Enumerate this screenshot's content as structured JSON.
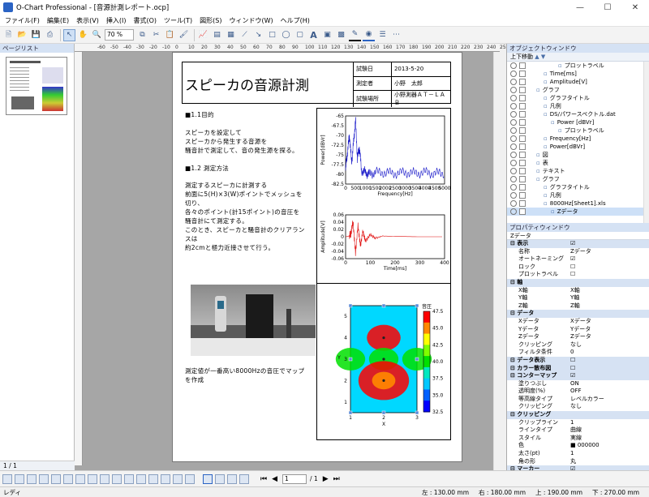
{
  "window": {
    "title": "O-Chart Professional - [音源計測レポート.ocp]"
  },
  "menu": [
    "ファイル(F)",
    "編集(E)",
    "表示(V)",
    "挿入(I)",
    "書式(O)",
    "ツール(T)",
    "図形(S)",
    "ウィンドウ(W)",
    "ヘルプ(H)"
  ],
  "toolbar": {
    "zoom": "70 %"
  },
  "pagelist": {
    "title": "ページリスト",
    "page_counter": "1 / 1"
  },
  "ruler": {
    "ticks": [
      "-60",
      "-50",
      "-40",
      "-30",
      "-20",
      "-10",
      "0",
      "10",
      "20",
      "30",
      "40",
      "50",
      "60",
      "70",
      "80",
      "90",
      "100",
      "110",
      "120",
      "130",
      "140",
      "150",
      "160",
      "170",
      "180",
      "190",
      "200",
      "210",
      "220",
      "230",
      "240",
      "250"
    ]
  },
  "report": {
    "title": "スピーカの音源計測",
    "info": [
      {
        "label": "試験日",
        "value": "2013-5-20"
      },
      {
        "label": "測定者",
        "value": "小野　太郎"
      },
      {
        "label": "試験場所",
        "value": "小野測器ＡＴ－ＬＡＢ"
      }
    ],
    "section1_heading": "■1.1目的",
    "section1_body": [
      "スピーカを設定して",
      "スピーカから発生する音源を",
      "騒音計で測定して、音の発生源を探る。"
    ],
    "section2_heading": "■1.2 測定方法",
    "section2_body": [
      "測定するスピーカに計測する",
      "前面に5(H)×3(W)ポイントでメッシュを",
      "切り、",
      "各々のポイント(計15ポイント)の音圧を",
      "騒音計にて測定する。",
      "このとき、スピーカと騒音計のクリアラン",
      "スは",
      "約2cmと極力近接させて行う。"
    ],
    "photo_caption": [
      "測定値が一番高い8000Hzの音圧でマップ",
      "を作成"
    ]
  },
  "colors": {
    "spectrum": "#1515c8",
    "waveform": "#e01010",
    "panel_head": "#d5e2f4",
    "selection": "#cde0f7"
  },
  "chart_data": [
    {
      "type": "line",
      "title": "",
      "xlabel": "Frequency[Hz]",
      "ylabel": "Power[dBVr]",
      "xlim": [
        0,
        5000
      ],
      "ylim": [
        -82.5,
        -65
      ],
      "x_ticks": [
        "0",
        "500",
        "1000",
        "1500",
        "2000",
        "2500",
        "3000",
        "3500",
        "4000",
        "4500",
        "5000"
      ],
      "y_ticks": [
        "-65",
        "-67.5",
        "-70",
        "-72.5",
        "-75",
        "-77.5",
        "-80",
        "-82.5"
      ],
      "series": [
        {
          "x": [
            0,
            100,
            200,
            300,
            400,
            500,
            600,
            700,
            800,
            1000,
            1200,
            1500,
            2000,
            2500,
            3000,
            3500,
            4000,
            4500,
            5000
          ],
          "values": [
            -79,
            -74,
            -70,
            -77,
            -72,
            -66,
            -76,
            -73,
            -79,
            -79.5,
            -80,
            -79.5,
            -79.5,
            -79.8,
            -79.5,
            -79.7,
            -79.5,
            -79.8,
            -79.6
          ]
        }
      ]
    },
    {
      "type": "line",
      "title": "",
      "xlabel": "Time[ms]",
      "ylabel": "Amplitude[V]",
      "xlim": [
        0,
        400
      ],
      "ylim": [
        -0.06,
        0.06
      ],
      "x_ticks": [
        "0",
        "100",
        "200",
        "300",
        "400"
      ],
      "y_ticks": [
        "0.06",
        "0.04",
        "0.02",
        "0",
        "-0.02",
        "-0.04",
        "-0.06"
      ],
      "series": [
        {
          "x": [
            0,
            10,
            20,
            30,
            40,
            50,
            60,
            70,
            80,
            100,
            120,
            150,
            200,
            300,
            400
          ],
          "values": [
            0,
            0.001,
            0.005,
            0.04,
            -0.045,
            0.03,
            -0.025,
            0.015,
            -0.012,
            0.006,
            -0.004,
            0.002,
            0.001,
            0,
            0
          ]
        }
      ]
    },
    {
      "type": "heatmap",
      "title": "",
      "xlabel": "X",
      "ylabel": "Y",
      "colorbar_label": "音圧",
      "x_ticks": [
        "1",
        "2",
        "3"
      ],
      "y_ticks": [
        "1",
        "2",
        "3",
        "4",
        "5"
      ],
      "colorbar_ticks": [
        "32.5",
        "35.0",
        "37.5",
        "40.0",
        "42.5",
        "45.0",
        "47.5"
      ],
      "zlim": [
        32.5,
        47.5
      ],
      "points": [
        {
          "x": 2,
          "y": 4,
          "z": 44
        },
        {
          "x": 2,
          "y": 3,
          "z": 37
        },
        {
          "x": 2,
          "y": 2,
          "z": 47.5
        },
        {
          "x": 1,
          "y": 3,
          "z": 40
        },
        {
          "x": 3,
          "y": 3,
          "z": 40
        }
      ]
    }
  ],
  "object_window": {
    "title": "オブジェクトウィンドウ",
    "toolbar": "上下移動",
    "tree": [
      {
        "label": "プロットラベル",
        "indent": 4
      },
      {
        "label": "Time[ms]",
        "indent": 2
      },
      {
        "label": "Amplitude[V]",
        "indent": 2
      },
      {
        "label": "グラフ",
        "indent": 1
      },
      {
        "label": "グラフタイトル",
        "indent": 2
      },
      {
        "label": "凡例",
        "indent": 2
      },
      {
        "label": "DS/パワースペクトル.dat",
        "indent": 2
      },
      {
        "label": "Power [dBVr]",
        "indent": 3
      },
      {
        "label": "プロットラベル",
        "indent": 4
      },
      {
        "label": "Frequency[Hz]",
        "indent": 2
      },
      {
        "label": "Power[dBVr]",
        "indent": 2
      },
      {
        "label": "図",
        "indent": 1
      },
      {
        "label": "表",
        "indent": 1
      },
      {
        "label": "テキスト",
        "indent": 1
      },
      {
        "label": "グラフ",
        "indent": 1
      },
      {
        "label": "グラフタイトル",
        "indent": 2
      },
      {
        "label": "凡例",
        "indent": 2
      },
      {
        "label": "8000Hz[Sheet1].xls",
        "indent": 2
      },
      {
        "label": "Zデータ",
        "indent": 3
      }
    ]
  },
  "property_window": {
    "title": "プロパティウィンドウ",
    "subject": "Zデータ",
    "rows": [
      {
        "k": "表示",
        "v": "☑",
        "sec": true
      },
      {
        "k": "名称",
        "v": "Zデータ"
      },
      {
        "k": "オートネーミング",
        "v": "☑"
      },
      {
        "k": "ロック",
        "v": "☐"
      },
      {
        "k": "プロットラベル",
        "v": "☐"
      },
      {
        "k": "軸",
        "v": "",
        "sec": true
      },
      {
        "k": "X軸",
        "v": "X軸"
      },
      {
        "k": "Y軸",
        "v": "Y軸"
      },
      {
        "k": "Z軸",
        "v": "Z軸"
      },
      {
        "k": "データ",
        "v": "",
        "sec": true
      },
      {
        "k": "Xデータ",
        "v": "Xデータ"
      },
      {
        "k": "Yデータ",
        "v": "Yデータ"
      },
      {
        "k": "Zデータ",
        "v": "Zデータ"
      },
      {
        "k": "クリッピング",
        "v": "なし"
      },
      {
        "k": "フィルタ条件",
        "v": "0"
      },
      {
        "k": "データ表示",
        "v": "☐",
        "sec": true
      },
      {
        "k": "カラー散布図",
        "v": "☐",
        "sec": true
      },
      {
        "k": "コンターマップ",
        "v": "☑",
        "sec": true
      },
      {
        "k": "塗りつぶし",
        "v": "ON"
      },
      {
        "k": "透明度(%)",
        "v": "OFF"
      },
      {
        "k": "等高線タイプ",
        "v": "レベルカラー"
      },
      {
        "k": "クリッピング",
        "v": "なし"
      },
      {
        "k": "クリッピング",
        "v": "",
        "sec": true
      },
      {
        "k": "クリップライン",
        "v": "1"
      },
      {
        "k": "ラインタイプ",
        "v": "曲線"
      },
      {
        "k": "スタイル",
        "v": "実線"
      },
      {
        "k": "色",
        "v": "■ 000000"
      },
      {
        "k": "太さ(pt)",
        "v": "1"
      },
      {
        "k": "角の形",
        "v": "丸"
      },
      {
        "k": "マーカー",
        "v": "☑",
        "sec": true
      }
    ]
  },
  "bottom": {
    "page_input": "1",
    "page_total": "/ 1"
  },
  "status": {
    "left_text": "レディ",
    "coords": [
      "左 : 130.00 mm",
      "右 : 180.00 mm",
      "上 : 190.00 mm",
      "下 : 270.00 mm"
    ]
  }
}
